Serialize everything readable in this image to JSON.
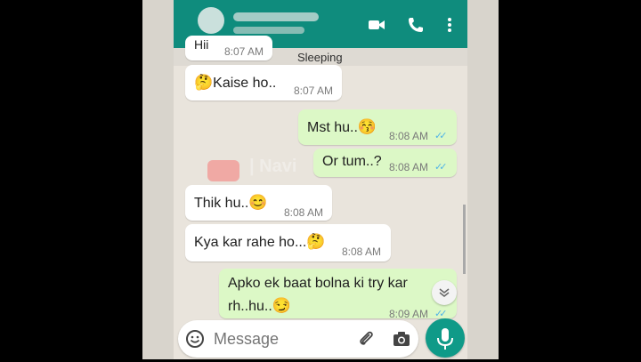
{
  "status": {
    "sleeping_text": "Sleeping"
  },
  "header": {
    "video_icon": "video-call-icon",
    "call_icon": "phone-call-icon",
    "menu_icon": "more-vert-icon"
  },
  "messages": [
    {
      "dir": "in",
      "text": "Hii",
      "time": "8:07 AM"
    },
    {
      "dir": "in",
      "text": "Kaise ho..",
      "emoji": "🤔",
      "emoji_position": "before",
      "time": "8:07 AM"
    },
    {
      "dir": "out",
      "text": "Mst hu..",
      "emoji": "😚",
      "time": "8:08 AM",
      "read": true
    },
    {
      "dir": "out",
      "text": "Or tum..?",
      "time": "8:08 AM",
      "read": true
    },
    {
      "dir": "in",
      "text": "Thik hu..",
      "emoji": "😊",
      "time": "8:08 AM"
    },
    {
      "dir": "in",
      "text": "Kya kar rahe ho...",
      "emoji": "🤔",
      "time": "8:08 AM"
    },
    {
      "dir": "out",
      "text_line1": "Apko ek baat bolna ki try kar",
      "text_line2": "rh..hu..",
      "emoji": "😏",
      "time": "8:09 AM",
      "read": true
    }
  ],
  "watermark": {
    "text": "| Navi"
  },
  "composer": {
    "placeholder": "Message",
    "emoji_icon": "emoji-icon",
    "attach_icon": "attach-icon",
    "camera_icon": "camera-icon",
    "mic_icon": "mic-icon"
  },
  "colors": {
    "header": "#0f8c7d",
    "outgoing_bubble": "#dcf8c6",
    "incoming_bubble": "#ffffff",
    "read_tick": "#4fb3e8",
    "mic_button": "#0f9a88"
  }
}
